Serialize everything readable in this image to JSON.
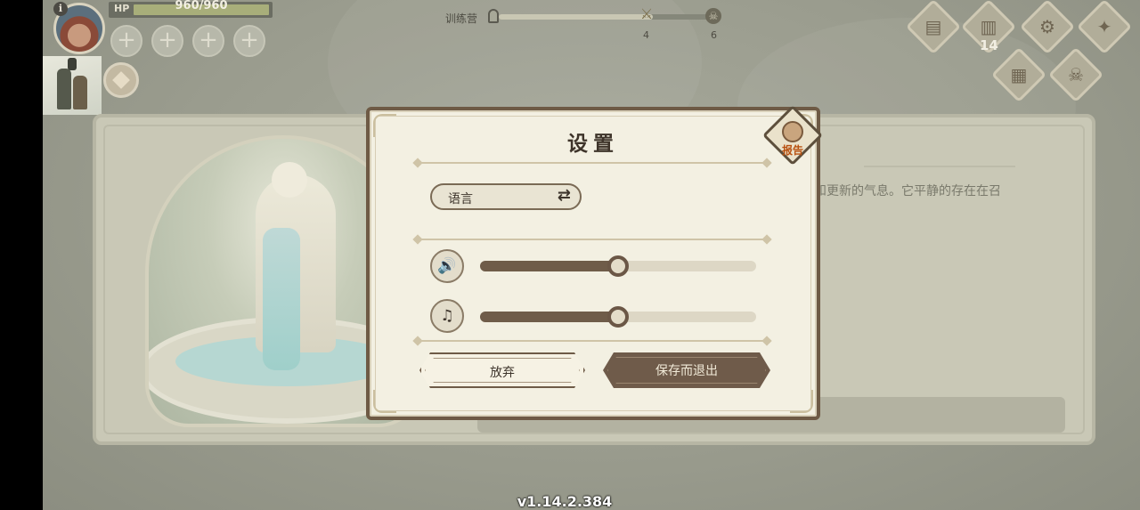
{
  "hud": {
    "hp_label": "HP",
    "hp_value": "960/960",
    "hp_fraction": 1.0,
    "plus_slots": [
      "+",
      "+",
      "+",
      "+"
    ],
    "info_icon": "i"
  },
  "progress": {
    "label": "训练营",
    "fraction": 0.72,
    "marker_1": "4",
    "marker_2": "6"
  },
  "top_buttons": {
    "cards_count": "14",
    "icons": [
      "scroll-icon",
      "cards-icon",
      "gear-icon",
      "compass-icon",
      "map-icon",
      "skull-icon"
    ]
  },
  "info_panel": {
    "text": "和更新的气息。它平静的存在在召"
  },
  "settings": {
    "title": "设置",
    "report_label": "报告",
    "language_label": "语言",
    "sound_volume": 0.5,
    "music_volume": 0.5,
    "discard_label": "放弃",
    "save_exit_label": "保存而退出"
  },
  "version": "v1.14.2.384",
  "colors": {
    "dialog_border": "#6e5a45",
    "button_dark": "#6f5b4a",
    "report_text": "#b8500f"
  }
}
